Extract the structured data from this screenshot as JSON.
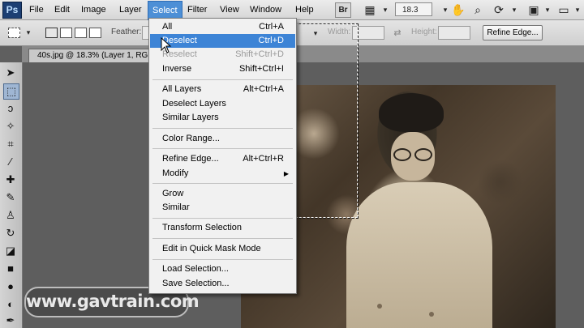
{
  "app": {
    "logo": "Ps"
  },
  "menubar": {
    "items": [
      "File",
      "Edit",
      "Image",
      "Layer",
      "Select",
      "Filter",
      "View",
      "Window",
      "Help"
    ],
    "active": "Select",
    "br_button": "Br",
    "zoom": "18.3"
  },
  "options": {
    "feather_label": "Feather:",
    "width_label": "Width:",
    "height_label": "Height:",
    "refine_edge_button": "Refine Edge..."
  },
  "document": {
    "tab_title": "40s.jpg @ 18.3% (Layer 1, RGB"
  },
  "select_menu": {
    "items": [
      {
        "label": "All",
        "shortcut": "Ctrl+A",
        "state": "normal"
      },
      {
        "label": "Deselect",
        "shortcut": "Ctrl+D",
        "state": "hover"
      },
      {
        "label": "Reselect",
        "shortcut": "Shift+Ctrl+D",
        "state": "disabled"
      },
      {
        "label": "Inverse",
        "shortcut": "Shift+Ctrl+I",
        "state": "normal"
      },
      {
        "label": "All Layers",
        "shortcut": "Alt+Ctrl+A",
        "state": "normal"
      },
      {
        "label": "Deselect Layers",
        "shortcut": "",
        "state": "normal"
      },
      {
        "label": "Similar Layers",
        "shortcut": "",
        "state": "normal"
      },
      {
        "label": "Color Range...",
        "shortcut": "",
        "state": "normal"
      },
      {
        "label": "Refine Edge...",
        "shortcut": "Alt+Ctrl+R",
        "state": "normal"
      },
      {
        "label": "Modify",
        "shortcut": "",
        "state": "submenu"
      },
      {
        "label": "Grow",
        "shortcut": "",
        "state": "normal"
      },
      {
        "label": "Similar",
        "shortcut": "",
        "state": "normal"
      },
      {
        "label": "Transform Selection",
        "shortcut": "",
        "state": "normal"
      },
      {
        "label": "Edit in Quick Mask Mode",
        "shortcut": "",
        "state": "normal"
      },
      {
        "label": "Load Selection...",
        "shortcut": "",
        "state": "normal"
      },
      {
        "label": "Save Selection...",
        "shortcut": "",
        "state": "normal"
      }
    ]
  },
  "watermark": "www.gavtrain.com",
  "icons": {
    "hand": "hand-icon",
    "zoom": "zoom-icon",
    "rotate": "rotate-view-icon",
    "arrange": "arrange-documents-icon",
    "screen_mode": "screen-mode-icon"
  }
}
